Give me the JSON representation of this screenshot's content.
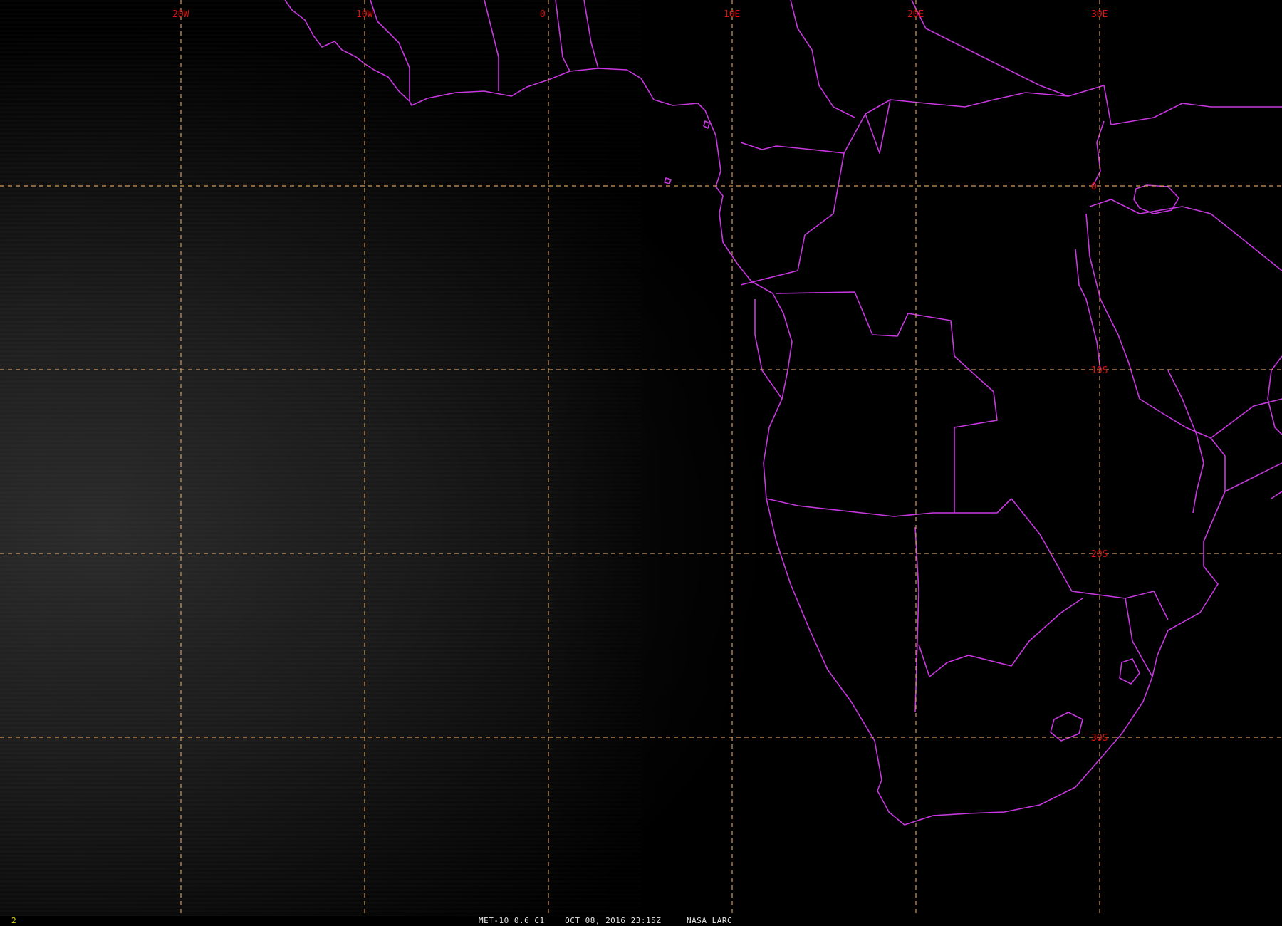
{
  "map": {
    "longitude_labels": [
      {
        "text": "20W",
        "lon": -20
      },
      {
        "text": "10W",
        "lon": -10
      },
      {
        "text": "0",
        "lon": 0
      },
      {
        "text": "10E",
        "lon": 10
      },
      {
        "text": "20E",
        "lon": 20
      },
      {
        "text": "30E",
        "lon": 30
      }
    ],
    "latitude_labels": [
      {
        "text": "0",
        "lat": 0
      },
      {
        "text": "10S",
        "lat": -10
      },
      {
        "text": "20S",
        "lat": -20
      },
      {
        "text": "30S",
        "lat": -30
      }
    ],
    "lon_range": [
      -30,
      40
    ],
    "lat_range": [
      -40,
      10
    ],
    "colors": {
      "background": "#000000",
      "coastline": "#c838e0",
      "gridline": "#d29a5a",
      "grid_label": "#e01010",
      "frame_number": "#d8d800",
      "caption": "#e6e6e6"
    }
  },
  "status_bar": {
    "frame_number": "2",
    "caption": "MET-10 0.6 C1    OCT 08, 2016 23:15Z     NASA LARC"
  }
}
